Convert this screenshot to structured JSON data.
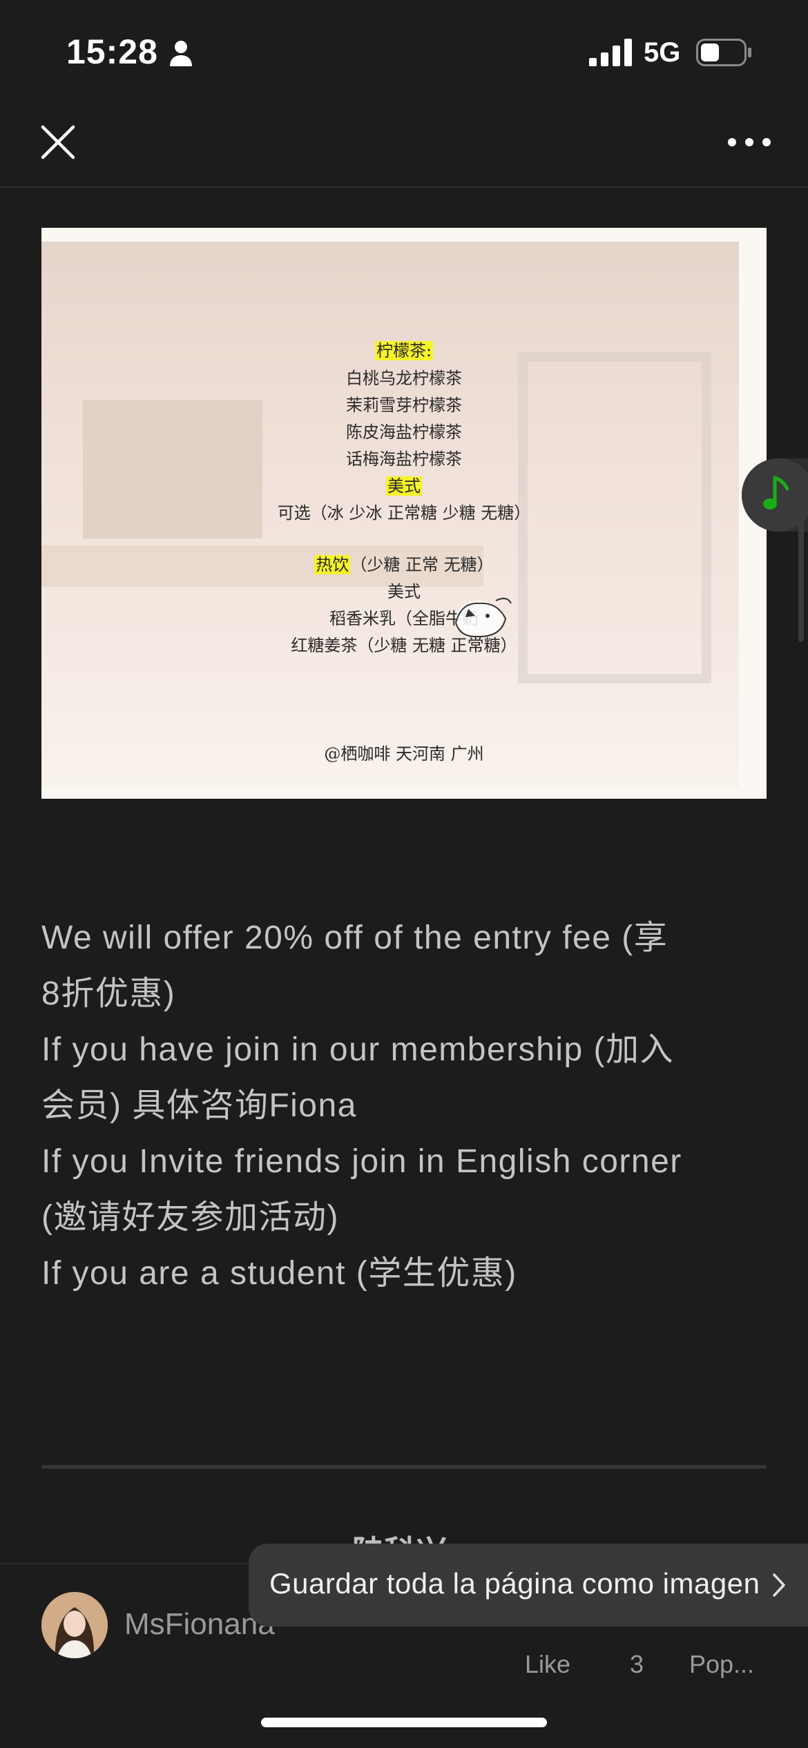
{
  "status_bar": {
    "time": "15:28",
    "network": "5G",
    "icons": [
      "person-icon",
      "signal-icon",
      "battery-icon"
    ]
  },
  "nav": {
    "close_icon": "close-icon",
    "more_icon": "more-icon"
  },
  "poster": {
    "lines": [
      "柠檬茶:",
      "白桃乌龙柠檬茶",
      "茉莉雪芽柠檬茶",
      "陈皮海盐柠檬茶",
      "话梅海盐柠檬茶",
      "美式",
      "可选（冰  少冰  正常糖  少糖  无糖）",
      "热饮",
      "（少糖  正常  无糖）",
      "美式",
      "稻香米乳（全脂牛奶",
      "红糖姜茶（少糖  无糖  正常糖）"
    ],
    "credit": "@栖咖啡  天河南  广州"
  },
  "article": {
    "lines": [
      "We will offer 20% off of the entry fee (享",
      "8折优惠)",
      "If you have join in our membership (加入",
      "会员) 具体咨询Fiona",
      "If you Invite friends join in English corner",
      "(邀请好友参加活动)",
      "If you are a student (学生优惠)"
    ]
  },
  "next_title": "陆科兴",
  "footer": {
    "author": "MsFionana",
    "like_label": "Like",
    "like_count": "3",
    "pop_label": "Pop..."
  },
  "toast": {
    "label": "Guardar toda la página como imagen"
  },
  "colors": {
    "background": "#1c1c1c",
    "highlight": "#f6f32a",
    "music_accent": "#1aad19"
  }
}
